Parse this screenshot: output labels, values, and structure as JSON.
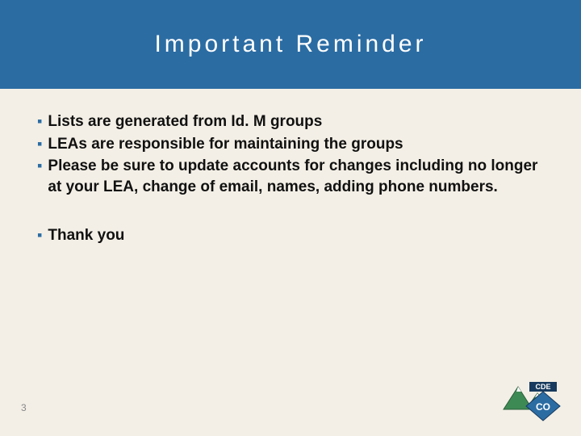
{
  "header": {
    "title": "Important Reminder"
  },
  "bullets_group1": [
    "Lists are generated from Id. M groups",
    "LEAs are responsible for maintaining the groups",
    "Please be sure to update accounts for changes including no longer at your LEA, change of email, names, adding phone numbers."
  ],
  "bullets_group2": [
    "Thank you"
  ],
  "page_number": "3",
  "logo": {
    "banner_text": "CDE",
    "badge_text": "CO"
  },
  "colors": {
    "header_bg": "#2b6ca3",
    "bullet": "#2b6ca3",
    "bg": "#f3efe6"
  }
}
